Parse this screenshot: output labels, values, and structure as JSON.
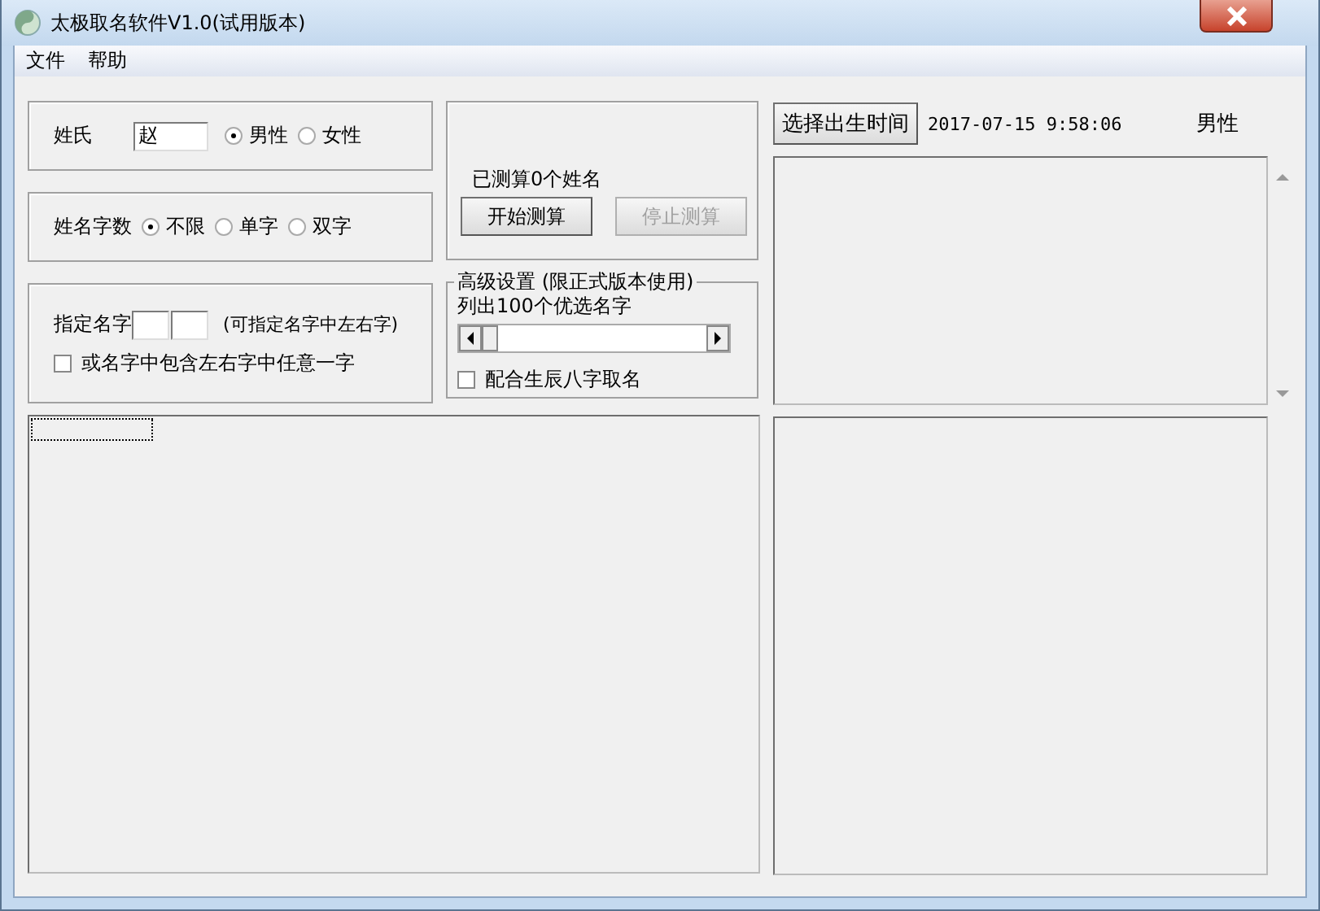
{
  "window": {
    "title": "太极取名软件V1.0(试用版本)"
  },
  "menu": [
    "文件",
    "帮助"
  ],
  "surname": {
    "label": "姓氏",
    "value": "赵",
    "genders": [
      {
        "label": "男性",
        "selected": true
      },
      {
        "label": "女性",
        "selected": false
      }
    ]
  },
  "name_length": {
    "label": "姓名字数",
    "options": [
      {
        "label": "不限",
        "selected": true
      },
      {
        "label": "单字",
        "selected": false
      },
      {
        "label": "双字",
        "selected": false
      }
    ]
  },
  "specify": {
    "label": "指定名字",
    "hint": "(可指定名字中左右字)",
    "any_char": {
      "label": "或名字中包含左右字中任意一字",
      "checked": false
    }
  },
  "calc": {
    "status": "已测算0个姓名",
    "buttons": [
      {
        "label": "开始测算",
        "disabled": false
      },
      {
        "label": "停止测算",
        "disabled": true
      }
    ]
  },
  "advanced": {
    "title": "高级设置 (限正式版本使用)",
    "list_label": "列出100个优选名字",
    "slider": {
      "level": 0.0
    },
    "bazi": {
      "label": "配合生辰八字取名",
      "checked": false
    }
  },
  "birth": {
    "button": "选择出生时间",
    "datetime": "2017-07-15 9:58:06",
    "gender": "男性"
  }
}
